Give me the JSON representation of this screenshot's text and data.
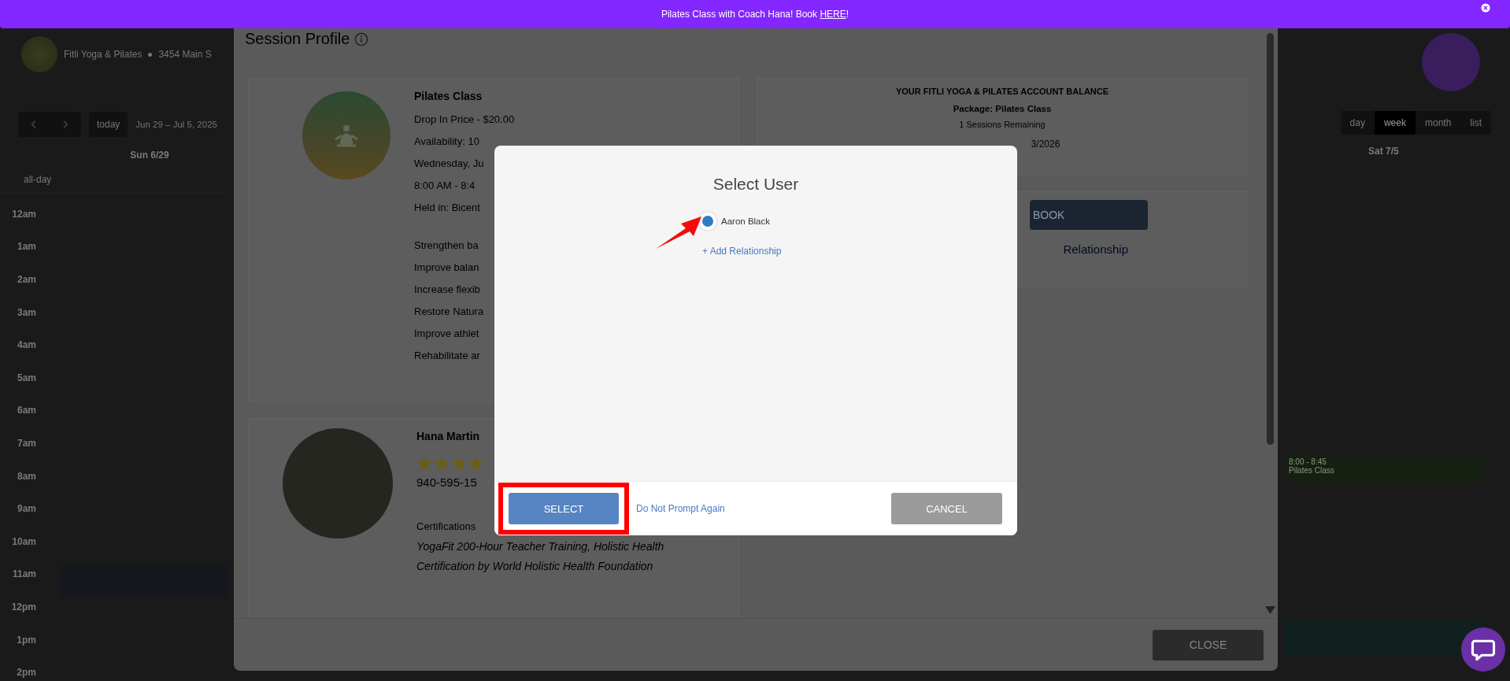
{
  "banner": {
    "message": "Pilates Class with Coach Hana! Book ",
    "link": "HERE",
    "suffix": "!"
  },
  "background_page": {
    "studio_name": "Fitli Yoga & Pilates",
    "address": "3454 Main S",
    "date_range": "Jun 29 – Jul 5, 2025",
    "today_button": "today",
    "day_header": "Sun 6/29",
    "all_day_label": "all-day",
    "hours": [
      "12am",
      "1am",
      "2am",
      "3am",
      "4am",
      "5am",
      "6am",
      "7am",
      "8am",
      "9am",
      "10am",
      "11am",
      "12pm",
      "1pm",
      "2pm"
    ],
    "view_tabs": [
      {
        "label": "day",
        "selected": false
      },
      {
        "label": "week",
        "selected": true
      },
      {
        "label": "month",
        "selected": false
      },
      {
        "label": "list",
        "selected": false
      }
    ],
    "right_day_header": "Sat 7/5",
    "events": [
      {
        "time": "8:00 - 8:45",
        "title": "Pilates Class"
      }
    ]
  },
  "session_profile": {
    "title": "Session Profile",
    "class_card": {
      "title": "Pilates Class",
      "details": [
        "Drop In Price - $20.00",
        "Availability: 10",
        "Wednesday, Ju",
        "8:00 AM - 8:4",
        "Held in: Bicent"
      ],
      "benefits": [
        "Strengthen ba",
        "Improve balan",
        "Increase flexib",
        "Restore Natura",
        "Improve athlet",
        "Rehabilitate ar"
      ]
    },
    "balance": {
      "heading": "YOUR FITLI YOGA & PILATES ACCOUNT BALANCE",
      "package": "Package: Pilates Class",
      "remaining": "1 Sessions Remaining",
      "expiry": "3/2026"
    },
    "book_button": "BOOK",
    "relationship_link": "Relationship",
    "instructor": {
      "name": "Hana Martin",
      "stars": 4,
      "phone": "940-595-15",
      "certifications_label": "Certifications",
      "certifications": "YogaFit 200-Hour Teacher Training, Holistic Health Certification by World Holistic Health Foundation"
    },
    "close_button": "CLOSE"
  },
  "modal": {
    "title": "Select User",
    "users": [
      {
        "name": "Aaron Black",
        "selected": true
      }
    ],
    "add_relationship": "+ Add Relationship",
    "select_button": "SELECT",
    "do_not_prompt": "Do Not Prompt Again",
    "cancel_button": "CANCEL"
  }
}
